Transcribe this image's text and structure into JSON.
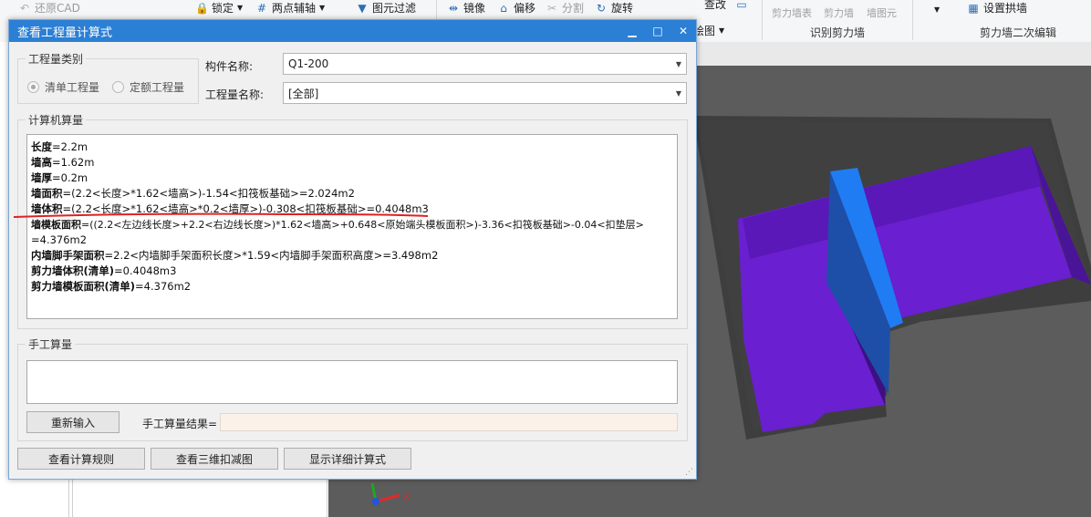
{
  "ribbon": {
    "restore_cad": "还原CAD",
    "lock": "锁定",
    "two_point_axis": "两点辅轴",
    "element_filter": "图元过滤",
    "mirror": "镜像",
    "offset": "偏移",
    "split": "分割",
    "rotate": "旋转",
    "query": "查改",
    "draw": "绘图",
    "recognize_wall_table": "剪力墙表",
    "recognize_wall": "剪力墙",
    "check_wall_element": "墙图元",
    "recognize_group": "识别剪力墙",
    "set_arch_wall": "设置拱墙",
    "wall_secondary_group": "剪力墙二次编辑"
  },
  "dialog": {
    "title": "查看工程量计算式",
    "minimize": "▁",
    "maximize": "□",
    "close": "✕",
    "quantity_type": {
      "legend": "工程量类别",
      "option_list": "清单工程量",
      "option_quota": "定额工程量"
    },
    "component_label": "构件名称:",
    "component_value": "Q1-200",
    "quantity_name_label": "工程量名称:",
    "quantity_name_value": "[全部]",
    "machine_legend": "计算机算量",
    "formulas": [
      {
        "name": "长度",
        "expr": "=2.2m"
      },
      {
        "name": "墙高",
        "expr": "=1.62m"
      },
      {
        "name": "墙厚",
        "expr": "=0.2m"
      },
      {
        "name": "墙面积",
        "expr": "=(2.2<长度>*1.62<墙高>)-1.54<扣筏板基础>=2.024m2"
      },
      {
        "name": "墙体积",
        "expr": "=(2.2<长度>*1.62<墙高>*0.2<墙厚>)-0.308<扣筏板基础>=0.4048m3"
      },
      {
        "name": "墙模板面积",
        "expr": "=((2.2<左边线长度>+2.2<右边线长度>)*1.62<墙高>+0.648<原始端头模板面积>)-3.36<扣筏板基础>-0.04<扣垫层>"
      },
      {
        "name": "",
        "expr": "=4.376m2"
      },
      {
        "name": "内墙脚手架面积",
        "expr": "=2.2<内墙脚手架面积长度>*1.59<内墙脚手架面积高度>=3.498m2"
      },
      {
        "name": "剪力墙体积(清单)",
        "expr": "=0.4048m3"
      },
      {
        "name": "剪力墙模板面积(清单)",
        "expr": "=4.376m2"
      }
    ],
    "manual_legend": "手工算量",
    "reenter_button": "重新输入",
    "manual_result_label": "手工算量结果=",
    "manual_result_value": "",
    "view_rules_button": "查看计算规则",
    "view_3d_button": "查看三维扣减图",
    "show_detail_button": "显示详细计算式"
  },
  "colors": {
    "title_bar": "#2b7fd4",
    "annotation_underline": "#e02020",
    "wall_blue": "#1f7cf2",
    "slab_purple": "#6a1fd0",
    "viewport_bg": "#5c5c5c"
  },
  "viewport": {
    "axis_x": "X"
  }
}
